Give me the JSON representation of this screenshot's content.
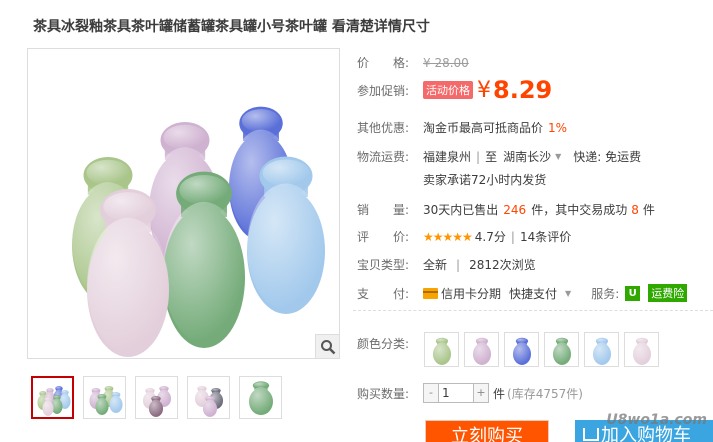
{
  "product": {
    "title": "茶具冰裂釉茶具茶叶罐储蓄罐茶具罐小号茶叶罐 看清楚详情尺寸"
  },
  "jar_colors": [
    "#a9c58a",
    "#cfb1d0",
    "#5a6fd8",
    "#74ab79",
    "#a2c9ec",
    "#e3cfdb"
  ],
  "price": {
    "label": "价　　格:",
    "original": "¥ 28.00"
  },
  "promo": {
    "label": "参加促销:",
    "tag": "活动价格",
    "currency": "¥",
    "price": "8.29"
  },
  "other": {
    "label": "其他优惠:",
    "text": "淘金币最高可抵商品价",
    "percent": "1%"
  },
  "shipping": {
    "label": "物流运费:",
    "from": "福建泉州",
    "divider": "|",
    "to_prefix": "至",
    "to_city": "湖南长沙",
    "fee": "快递: 免运费",
    "promise": "卖家承诺72小时内发货"
  },
  "sales": {
    "label": "销　　量:",
    "prefix": "30天内已售出",
    "sold": "246",
    "mid": "件，其中交易成功",
    "success": "8",
    "suffix": "件"
  },
  "rating": {
    "label": "评　　价:",
    "stars": "★★★★★",
    "score": "4.7分",
    "divider": "|",
    "reviews": "14条评价"
  },
  "type": {
    "label": "宝贝类型:",
    "condition": "全新",
    "divider": "|",
    "views": "2812次浏览"
  },
  "payment": {
    "label": "支　　付:",
    "credit": "信用卡分期",
    "quick": "快捷支付",
    "service_label": "服务:",
    "shield": "U",
    "freight": "运费险"
  },
  "color": {
    "label": "颜色分类:"
  },
  "quantity": {
    "label": "购买数量:",
    "minus": "-",
    "value": "1",
    "plus": "+",
    "unit": "件",
    "stock": "(库存4757件)"
  },
  "actions": {
    "buy": "立刻购买",
    "cart": "加入购物车"
  },
  "watermark": "U8wo1a.com"
}
